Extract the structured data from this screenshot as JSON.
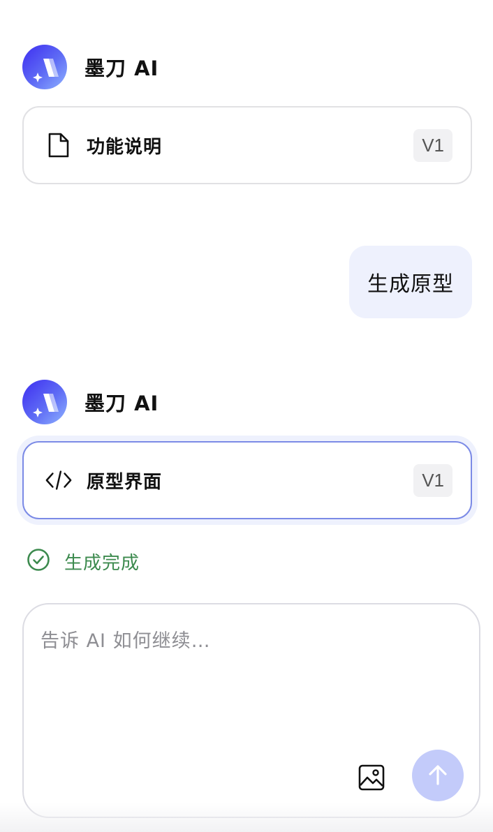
{
  "messages": [
    {
      "assistant_name": "墨刀 AI",
      "card": {
        "title": "功能说明",
        "version": "V1",
        "icon": "document-icon"
      }
    },
    {
      "user_text": "生成原型"
    },
    {
      "assistant_name": "墨刀 AI",
      "card": {
        "title": "原型界面",
        "version": "V1",
        "icon": "code-icon"
      },
      "status": {
        "text": "生成完成",
        "icon": "check-circle-icon"
      }
    }
  ],
  "composer": {
    "placeholder": "告诉 AI 如何继续…",
    "value": "",
    "image_icon": "image-icon",
    "send_icon": "arrow-up-icon"
  },
  "colors": {
    "brand_gradient_start": "#3d2df0",
    "brand_gradient_end": "#8fb3ff",
    "user_bubble": "#eef1fd",
    "selected_border": "#7b8ae6",
    "status_green": "#3c8a4e",
    "send_button": "#c3cbfa"
  }
}
